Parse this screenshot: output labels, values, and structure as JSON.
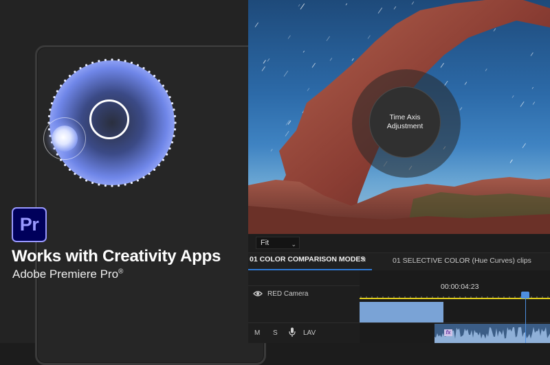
{
  "promo": {
    "logo_text": "Pr",
    "title": "Works with Creativity Apps",
    "subtitle": "Adobe Premiere Pro",
    "subtitle_mark": "®"
  },
  "preview": {
    "overlay_label": "Time Axis Adjustment",
    "zoom_select": "Fit"
  },
  "tabs": {
    "active": "01 COLOR COMPARISON MODES",
    "menu_icon": "≡",
    "inactive": "01 SELECTIVE COLOR (Hue Curves) clips"
  },
  "timeline": {
    "timecode": "00:00:04:23",
    "video_track": "RED Camera",
    "audio_mute": "M",
    "audio_solo": "S",
    "audio_track": "LAV",
    "fx_badge": "fx"
  },
  "colors": {
    "accent": "#2f7bd8",
    "playhead": "#4d8fe0",
    "in_out_bar": "#e2cf1b",
    "premiere_purple": "#9999ff"
  }
}
